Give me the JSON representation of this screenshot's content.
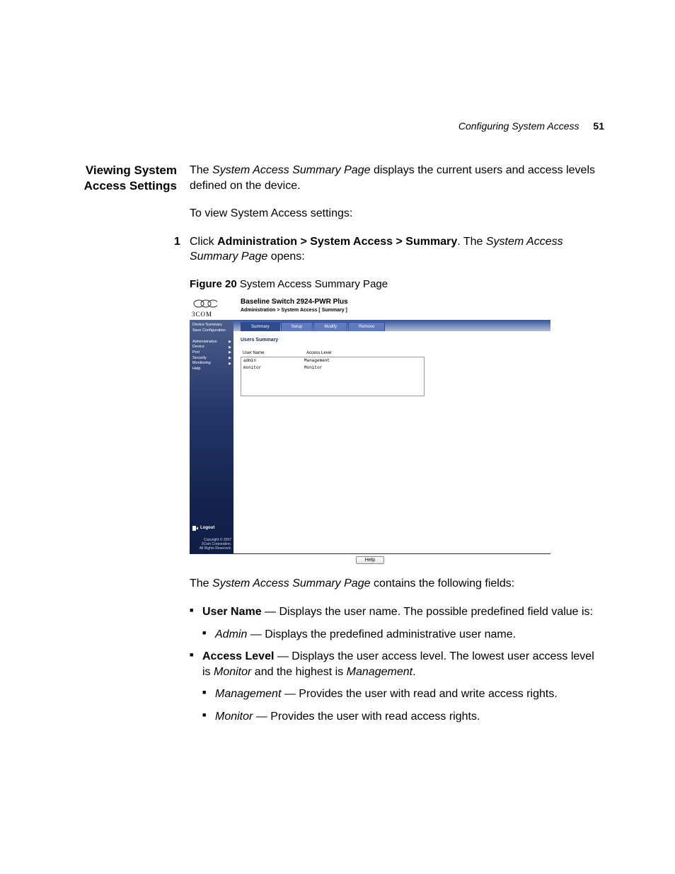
{
  "runningHead": {
    "title": "Configuring System Access",
    "page": "51"
  },
  "sideHeading": "Viewing System Access Settings",
  "intro": {
    "pageName": "System Access Summary Page",
    "tail": " displays the current users and access levels defined on the device."
  },
  "lead2": "To view System Access settings:",
  "step1": {
    "num": "1",
    "pre": "Click ",
    "nav": "Administration > System Access > Summary",
    "mid": ". The ",
    "pageName": "System Access Summary Page",
    "post": " opens:"
  },
  "figCaption": {
    "label": "Figure 20",
    "text": "   System Access Summary Page"
  },
  "figure": {
    "brand": "3COM",
    "product": "Baseline Switch 2924-PWR Plus",
    "breadcrumb": "Administration > System Access [ Summary ]",
    "nav": {
      "top": [
        "Device Summary",
        "Save Configuration"
      ],
      "items": [
        "Administration",
        "Device",
        "Port",
        "Security",
        "Monitoring"
      ],
      "help": "Help",
      "logout": "Logout",
      "legal1": "Copyright © 2007",
      "legal2": "3Com Corporation.",
      "legal3": "All Rights Reserved."
    },
    "tabs": [
      "Summary",
      "Setup",
      "Modify",
      "Remove"
    ],
    "panelTitle": "Users Summary",
    "table": {
      "headers": [
        "User Name",
        "Access Level"
      ],
      "rows": [
        [
          "admin",
          "Management"
        ],
        [
          "monitor",
          "Monitor"
        ]
      ]
    },
    "helpBtn": "Help"
  },
  "afterFig": {
    "pre": "The ",
    "pageName": "System Access Summary Page",
    "post": " contains the following fields:"
  },
  "fields": {
    "userName": {
      "label": "User Name",
      "desc": " — Displays the user name. The possible predefined field value is:",
      "sub": {
        "label": "Admin",
        "desc": " — Displays the predefined administrative user name."
      }
    },
    "accessLevel": {
      "label": "Access Level",
      "desc1": " — Displays the user access level. The lowest user access level is ",
      "it1": "Monitor",
      "desc2": " and the highest is ",
      "it2": "Management",
      "desc3": ".",
      "subs": [
        {
          "label": "Management",
          "desc": " — Provides the user with read and write access rights."
        },
        {
          "label": "Monitor",
          "desc": " — Provides the user with read access rights."
        }
      ]
    }
  }
}
